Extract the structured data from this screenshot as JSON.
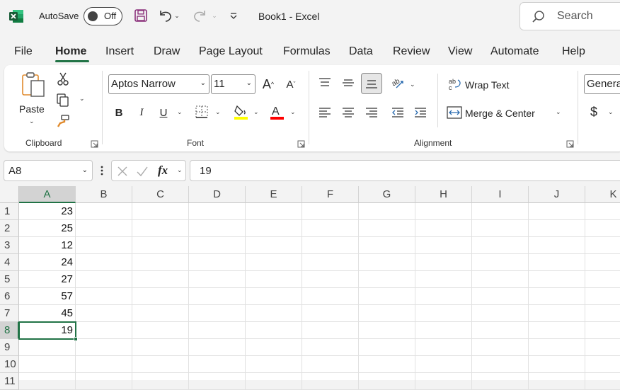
{
  "titlebar": {
    "autosave_label": "AutoSave",
    "autosave_state": "Off",
    "document_title": "Book1  -  Excel",
    "search_placeholder": "Search"
  },
  "tabs": [
    {
      "label": "File"
    },
    {
      "label": "Home",
      "active": true
    },
    {
      "label": "Insert"
    },
    {
      "label": "Draw"
    },
    {
      "label": "Page Layout"
    },
    {
      "label": "Formulas"
    },
    {
      "label": "Data"
    },
    {
      "label": "Review"
    },
    {
      "label": "View"
    },
    {
      "label": "Automate"
    },
    {
      "label": "Help"
    }
  ],
  "ribbon": {
    "clipboard": {
      "label": "Clipboard",
      "paste_label": "Paste"
    },
    "font": {
      "label": "Font",
      "font_name": "Aptos Narrow",
      "font_size": "11",
      "bold": "B",
      "italic": "I",
      "underline": "U"
    },
    "alignment": {
      "label": "Alignment",
      "wrap_text": "Wrap Text",
      "merge_center": "Merge & Center"
    },
    "number": {
      "format": "General",
      "currency_symbol": "$"
    }
  },
  "colors": {
    "accent": "#217346",
    "highlight": "#ffff00",
    "font_color": "#ff0000"
  },
  "formula_bar": {
    "name_box": "A8",
    "fx_label": "fx",
    "formula": "19"
  },
  "sheet": {
    "columns": [
      "A",
      "B",
      "C",
      "D",
      "E",
      "F",
      "G",
      "H",
      "I",
      "J",
      "K"
    ],
    "rows": [
      "1",
      "2",
      "3",
      "4",
      "5",
      "6",
      "7",
      "8",
      "9",
      "10",
      "11"
    ],
    "selected_column": "A",
    "selected_row": "8",
    "column_a_values": [
      "23",
      "25",
      "12",
      "24",
      "27",
      "57",
      "45",
      "19",
      "",
      "",
      ""
    ]
  }
}
